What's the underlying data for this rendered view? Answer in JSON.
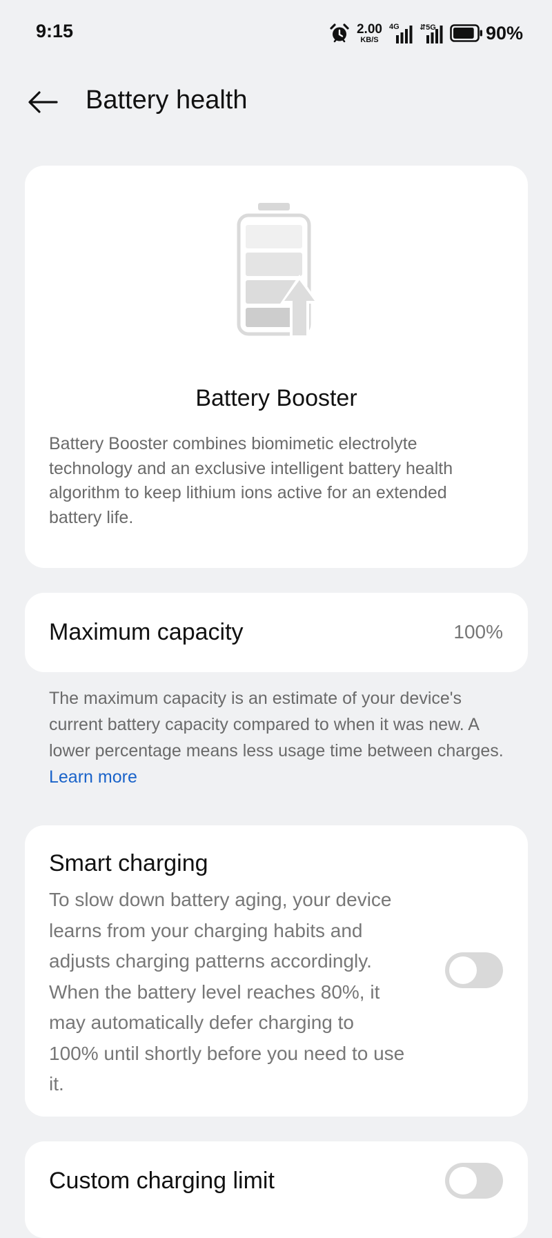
{
  "status_bar": {
    "time": "9:15",
    "net_speed_value": "2.00",
    "net_speed_unit": "KB/S",
    "sim1_label": "4G",
    "sim2_label": "⇵5G",
    "battery_percent": "90%",
    "battery_level": 0.9
  },
  "header": {
    "title": "Battery health"
  },
  "booster": {
    "title": "Battery Booster",
    "description": "Battery Booster combines biomimetic electrolyte technology and an exclusive intelligent battery health algorithm to keep lithium ions active for an extended battery life."
  },
  "capacity": {
    "label": "Maximum capacity",
    "value": "100%",
    "note": "The maximum capacity is an estimate of your device's current battery capacity compared to when it was new. A lower percentage means less usage time between charges.",
    "learn_more": "Learn more"
  },
  "smart_charging": {
    "title": "Smart charging",
    "description": "To slow down battery aging, your device learns from your charging habits and adjusts charging patterns accordingly. When the battery level reaches 80%, it may automatically defer charging to 100% until shortly before you need to use it.",
    "enabled": false
  },
  "custom_limit": {
    "label": "Custom charging limit",
    "enabled": false
  },
  "colors": {
    "background": "#f0f1f3",
    "card": "#ffffff",
    "link": "#1a63c9",
    "toggle_off": "#d9d9d9"
  }
}
